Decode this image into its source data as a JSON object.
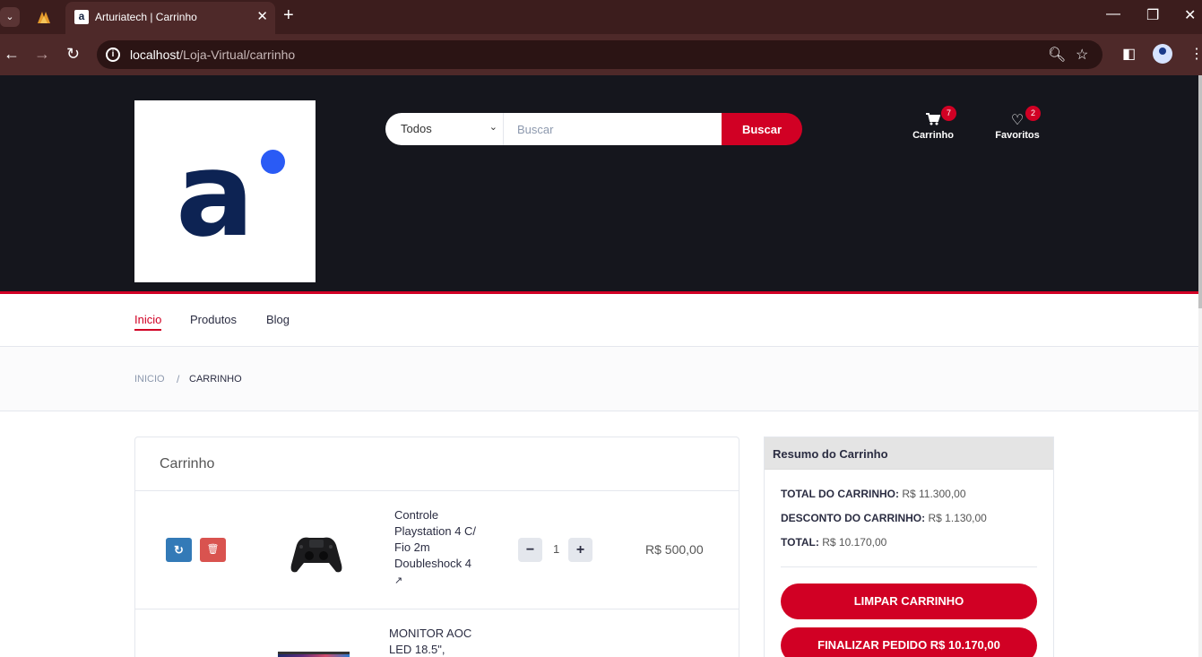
{
  "browser": {
    "tab_title": "Arturiatech | Carrinho",
    "tab_favicon": "a",
    "url_host": "localhost",
    "url_path": "/Loja-Virtual/carrinho"
  },
  "search": {
    "category": "Todos",
    "placeholder": "Buscar",
    "button": "Buscar"
  },
  "header_actions": {
    "cart_label": "Carrinho",
    "cart_count": "7",
    "wishlist_label": "Favoritos",
    "wishlist_count": "2"
  },
  "nav": {
    "items": [
      "Inicio",
      "Produtos",
      "Blog"
    ],
    "active": "Inicio"
  },
  "breadcrumb": {
    "home": "INICIO",
    "separator": "/",
    "current": "CARRINHO"
  },
  "cart": {
    "title": "Carrinho",
    "items": [
      {
        "name": "Controle Playstation 4 C/ Fio 2m Doubleshock 4",
        "qty": "1",
        "price": "R$ 500,00"
      },
      {
        "name": "MONITOR AOC LED 18.5\",",
        "qty": "",
        "price": ""
      }
    ]
  },
  "summary": {
    "title": "Resumo do Carrinho",
    "total_label": "TOTAL DO CARRINHO:",
    "total_value": "R$ 11.300,00",
    "discount_label": "DESCONTO DO CARRINHO:",
    "discount_value": "R$ 1.130,00",
    "final_label": "TOTAL:",
    "final_value": "R$ 10.170,00",
    "clear_button": "LIMPAR CARRINHO",
    "checkout_button": "FINALIZAR PEDIDO R$ 10.170,00"
  },
  "colors": {
    "header_bg": "#15161d",
    "accent": "#d10024",
    "browser_frame": "#4e2929",
    "logo_text": "#0d2353",
    "logo_dot": "#2a5bf5"
  },
  "icons": [
    "refresh-icon",
    "trash-icon",
    "external-link-icon",
    "cart-icon",
    "heart-icon",
    "zoom-icon",
    "star-icon"
  ]
}
